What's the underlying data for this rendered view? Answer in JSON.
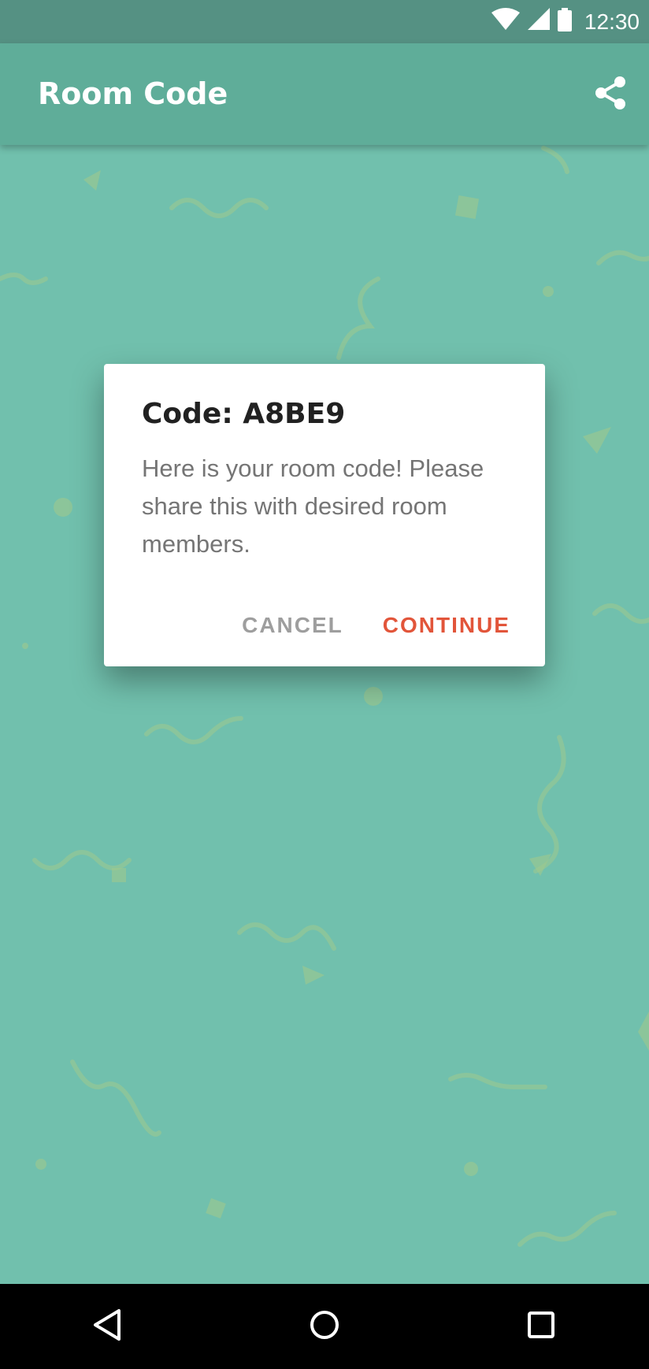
{
  "status_bar": {
    "time": "12:30",
    "icons": [
      "wifi-icon",
      "signal-icon",
      "battery-icon"
    ]
  },
  "app_bar": {
    "title": "Room Code",
    "share_icon": "share-icon"
  },
  "dialog": {
    "title": "Code: A8BE9",
    "message": "Here is your room code! Please share this with desired room members.",
    "cancel_label": "CANCEL",
    "continue_label": "CONTINUE"
  },
  "nav_bar": {
    "icons": [
      "back-icon",
      "home-icon",
      "recents-icon"
    ]
  },
  "colors": {
    "status_bar": "#559183",
    "app_bar": "#5fad99",
    "background": "#71c0ad",
    "accent": "#e2553a",
    "cancel": "#9e9e9e"
  }
}
